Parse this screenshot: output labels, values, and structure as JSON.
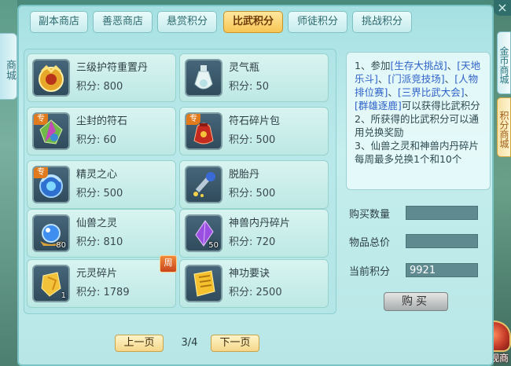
{
  "window": {
    "close_symbol": "×"
  },
  "side_tabs": {
    "left": "商城",
    "right_gold": "金币商城",
    "right_point": "积分商城",
    "appearance": "外观商"
  },
  "tabs": [
    {
      "label": "副本商店",
      "active": false
    },
    {
      "label": "善恶商店",
      "active": false
    },
    {
      "label": "悬赏积分",
      "active": false
    },
    {
      "label": "比武积分",
      "active": true
    },
    {
      "label": "师徒积分",
      "active": false
    },
    {
      "label": "挑战积分",
      "active": false
    }
  ],
  "items": [
    {
      "name": "三级护符重置丹",
      "points_label": "积分: 800",
      "icon": "amulet-pill-icon"
    },
    {
      "name": "灵气瓶",
      "points_label": "积分: 50",
      "icon": "spirit-bottle-icon"
    },
    {
      "name": "尘封的符石",
      "points_label": "积分: 60",
      "icon": "sealed-rune-stone-icon",
      "badge": "专"
    },
    {
      "name": "符石碎片包",
      "points_label": "积分: 500",
      "icon": "rune-fragment-bag-icon",
      "badge": "专"
    },
    {
      "name": "精灵之心",
      "points_label": "积分: 500",
      "icon": "elf-heart-icon",
      "badge": "专"
    },
    {
      "name": "脱胎丹",
      "points_label": "积分: 500",
      "icon": "rebirth-pill-icon"
    },
    {
      "name": "仙兽之灵",
      "points_label": "积分: 810",
      "icon": "beast-spirit-orb-icon",
      "qty": "80"
    },
    {
      "name": "神兽内丹碎片",
      "points_label": "积分: 720",
      "icon": "beast-core-shard-icon",
      "qty": "50"
    },
    {
      "name": "元灵碎片",
      "points_label": "积分: 1789",
      "icon": "yuanling-shard-icon",
      "qty": "1",
      "week_badge": "周"
    },
    {
      "name": "神功要诀",
      "points_label": "积分: 2500",
      "icon": "skill-manual-icon"
    }
  ],
  "info": {
    "line1_prefix": "1、参加",
    "event1": "[生存大挑战]",
    "sep1": "、",
    "event2": "[天地乐斗]",
    "sep2": "、",
    "event3": "[门派竞技场]",
    "sep3": "、",
    "event4": "[人物排位赛]",
    "sep4": "、",
    "event5": "[三界比武大会]",
    "sep5": "、",
    "event6": "[群雄逐鹿]",
    "line1_suffix": "可以获得比武积分",
    "line2": "2、所获得的比武积分可以通用兑换奖励",
    "line3": "3、仙兽之灵和神兽内丹碎片每周最多兑换1个和10个"
  },
  "form": {
    "qty_label": "购买数量",
    "qty_value": "",
    "total_label": "物品总价",
    "total_value": "",
    "current_label": "当前积分",
    "current_value": "9921"
  },
  "buy_button": "购买",
  "pagination": {
    "prev": "上一页",
    "indicator": "3/4",
    "next": "下一页"
  }
}
